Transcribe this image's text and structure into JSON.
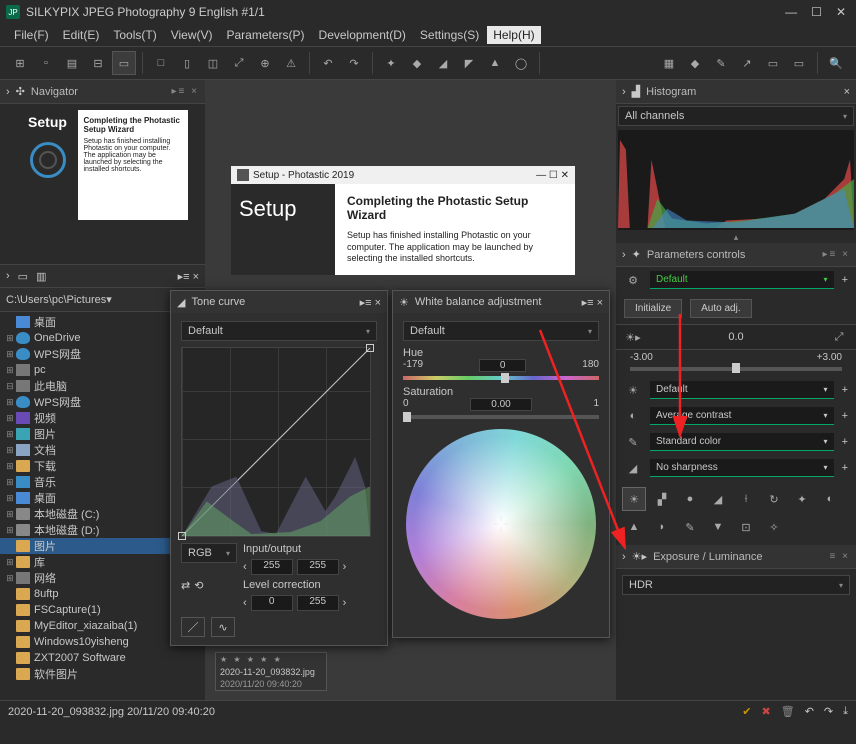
{
  "app": {
    "title": "SILKYPIX JPEG Photography 9 English  #1/1"
  },
  "menu": {
    "file": "File(F)",
    "edit": "Edit(E)",
    "tools": "Tools(T)",
    "view": "View(V)",
    "parameters": "Parameters(P)",
    "development": "Development(D)",
    "settings": "Settings(S)",
    "help": "Help(H)"
  },
  "navigator": {
    "title": "Navigator"
  },
  "path": {
    "value": "C:\\Users\\pc\\Pictures"
  },
  "tree": {
    "items": [
      {
        "label": "桌面",
        "indent": 0,
        "exp": "",
        "icon": "ic-desktop"
      },
      {
        "label": "OneDrive",
        "indent": 1,
        "exp": "⊞",
        "icon": "ic-cloud"
      },
      {
        "label": "WPS网盘",
        "indent": 1,
        "exp": "⊞",
        "icon": "ic-cloud"
      },
      {
        "label": "pc",
        "indent": 1,
        "exp": "⊞",
        "icon": "ic-pc"
      },
      {
        "label": "此电脑",
        "indent": 1,
        "exp": "⊟",
        "icon": "ic-pc"
      },
      {
        "label": "WPS网盘",
        "indent": 2,
        "exp": "⊞",
        "icon": "ic-cloud"
      },
      {
        "label": "视频",
        "indent": 2,
        "exp": "⊞",
        "icon": "ic-vid"
      },
      {
        "label": "图片",
        "indent": 2,
        "exp": "⊞",
        "icon": "ic-pic"
      },
      {
        "label": "文档",
        "indent": 2,
        "exp": "⊞",
        "icon": "ic-doc"
      },
      {
        "label": "下载",
        "indent": 2,
        "exp": "⊞",
        "icon": "ic-folder"
      },
      {
        "label": "音乐",
        "indent": 2,
        "exp": "⊞",
        "icon": "ic-music"
      },
      {
        "label": "桌面",
        "indent": 2,
        "exp": "⊞",
        "icon": "ic-desktop"
      },
      {
        "label": "本地磁盘 (C:)",
        "indent": 2,
        "exp": "⊞",
        "icon": "ic-drive"
      },
      {
        "label": "本地磁盘 (D:)",
        "indent": 2,
        "exp": "⊞",
        "icon": "ic-drive"
      },
      {
        "label": "图片",
        "indent": 2,
        "exp": "",
        "icon": "ic-folder",
        "sel": true
      },
      {
        "label": "库",
        "indent": 1,
        "exp": "⊞",
        "icon": "ic-folder"
      },
      {
        "label": "网络",
        "indent": 1,
        "exp": "⊞",
        "icon": "ic-pc"
      },
      {
        "label": "8uftp",
        "indent": 1,
        "exp": "",
        "icon": "ic-folder"
      },
      {
        "label": "FSCapture(1)",
        "indent": 1,
        "exp": "",
        "icon": "ic-folder"
      },
      {
        "label": "MyEditor_xiazaiba(1)",
        "indent": 1,
        "exp": "",
        "icon": "ic-folder"
      },
      {
        "label": "Windows10yisheng",
        "indent": 1,
        "exp": "",
        "icon": "ic-folder"
      },
      {
        "label": "ZXT2007 Software",
        "indent": 1,
        "exp": "",
        "icon": "ic-folder"
      },
      {
        "label": "软件图片",
        "indent": 1,
        "exp": "",
        "icon": "ic-folder"
      }
    ]
  },
  "setup": {
    "window_title": "Setup - Photastic 2019",
    "dark": "Setup",
    "heading": "Completing the Photastic Setup Wizard",
    "body": "Setup has finished installing Photastic on your computer. The application may be launched by selecting the installed shortcuts."
  },
  "thumb": {
    "name": "2020-11-20_093832.jpg",
    "date": "2020/11/20 09:40:20"
  },
  "tonecurve": {
    "title": "Tone curve",
    "preset": "Default",
    "channel": "RGB",
    "io_label": "Input/output",
    "in": "255",
    "out": "255",
    "level_label": "Level correction",
    "lv1": "0",
    "lv2": "255"
  },
  "wb": {
    "title": "White balance adjustment",
    "preset": "Default",
    "hue_label": "Hue",
    "hue_min": "-179",
    "hue_val": "0",
    "hue_max": "180",
    "sat_label": "Saturation",
    "sat_min": "0",
    "sat_val": "0.00",
    "sat_max": "1"
  },
  "right": {
    "hist_title": "Histogram",
    "hist_channel": "All channels",
    "params_title": "Parameters controls",
    "preset": "Default",
    "btn_init": "Initialize",
    "btn_auto": "Auto adj.",
    "exposure_val": "0.0",
    "exposure_min": "-3.00",
    "exposure_max": "+3.00",
    "dd1": "Default",
    "dd2": "Average contrast",
    "dd3": "Standard color",
    "dd4": "No sharpness",
    "exp_panel": "Exposure / Luminance",
    "hdr": "HDR"
  },
  "status": {
    "text": "2020-11-20_093832.jpg 20/11/20 09:40:20"
  }
}
